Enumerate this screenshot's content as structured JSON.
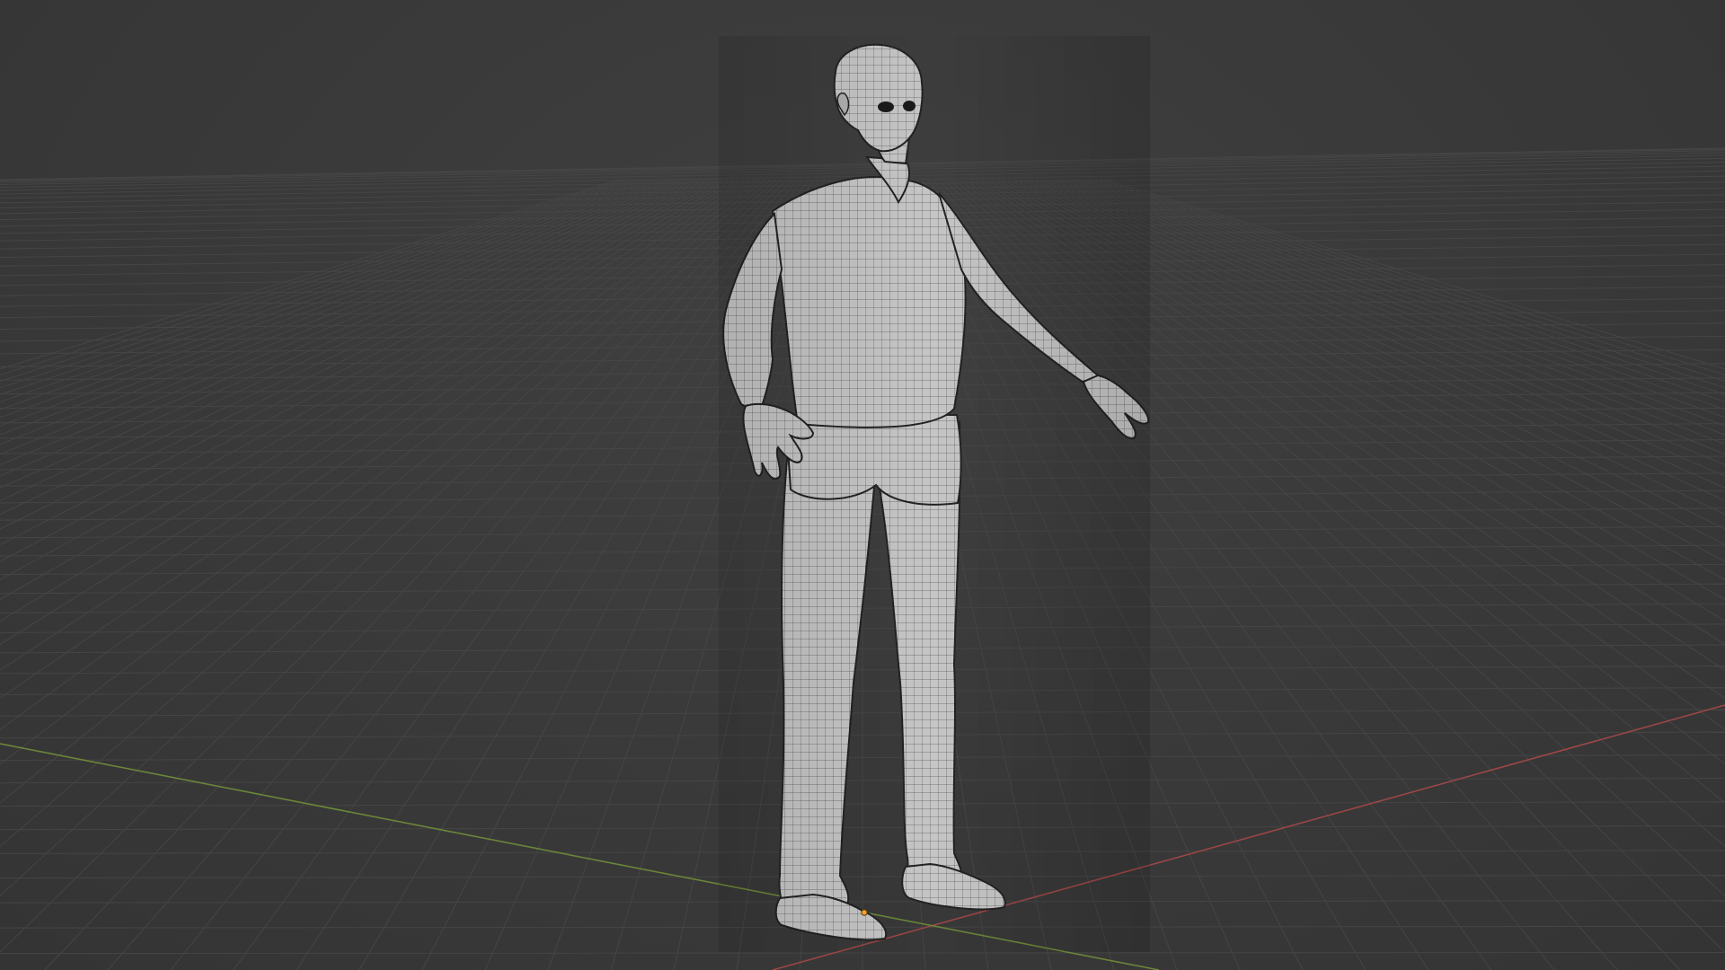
{
  "viewport": {
    "background_color": "#3a3a3a",
    "grid_line_color": "#454545",
    "x_axis_color": "#a34a4a",
    "y_axis_color": "#6f8a3c",
    "object_origin_color": "#f0a030"
  },
  "object": {
    "kind": "character mesh in wireframe overlay",
    "pose": "A-pose standing",
    "surface_color": "#c9c9c9",
    "wire_color": "#2a2a2a"
  }
}
